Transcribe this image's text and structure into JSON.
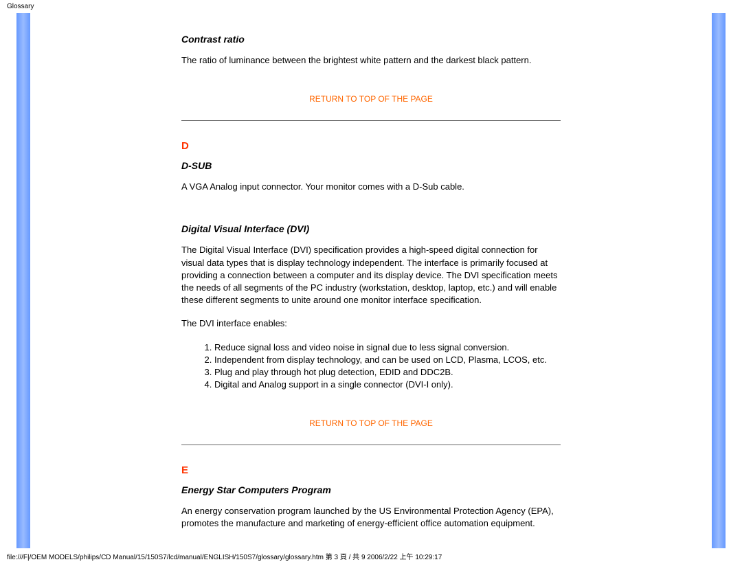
{
  "header": {
    "title": "Glossary"
  },
  "content": {
    "contrast_ratio": {
      "heading": "Contrast ratio",
      "body": "The ratio of luminance between the brightest white pattern and the darkest black pattern."
    },
    "return_link_1": "RETURN TO TOP OF THE PAGE",
    "letter_d": "D",
    "dsub": {
      "heading": "D-SUB",
      "body": "A VGA Analog input connector. Your monitor comes with a D-Sub cable."
    },
    "dvi": {
      "heading": "Digital Visual Interface (DVI)",
      "body1": "The Digital Visual Interface (DVI) specification provides a high-speed digital connection for visual data types that is display technology independent. The interface is primarily focused at providing a connection between a computer and its display device. The DVI specification meets the needs of all segments of the PC industry (workstation, desktop, laptop, etc.) and will enable these different segments to unite around one monitor interface specification.",
      "body2": "The DVI interface enables:",
      "list": [
        "Reduce signal loss and video noise in signal due to less signal conversion.",
        "Independent from display technology, and can be used on LCD, Plasma, LCOS, etc.",
        "Plug and play through hot plug detection, EDID and DDC2B.",
        "Digital and Analog support in a single connector (DVI-I only)."
      ]
    },
    "return_link_2": "RETURN TO TOP OF THE PAGE",
    "letter_e": "E",
    "energy_star": {
      "heading": "Energy Star Computers Program",
      "body": "An energy conservation program launched by the US Environmental Protection Agency (EPA), promotes the manufacture and marketing of energy-efficient office automation equipment."
    }
  },
  "footer": {
    "path": "file:///F|/OEM MODELS/philips/CD Manual/15/150S7/lcd/manual/ENGLISH/150S7/glossary/glossary.htm 第 3 頁 / 共 9 2006/2/22 上午 10:29:17"
  }
}
